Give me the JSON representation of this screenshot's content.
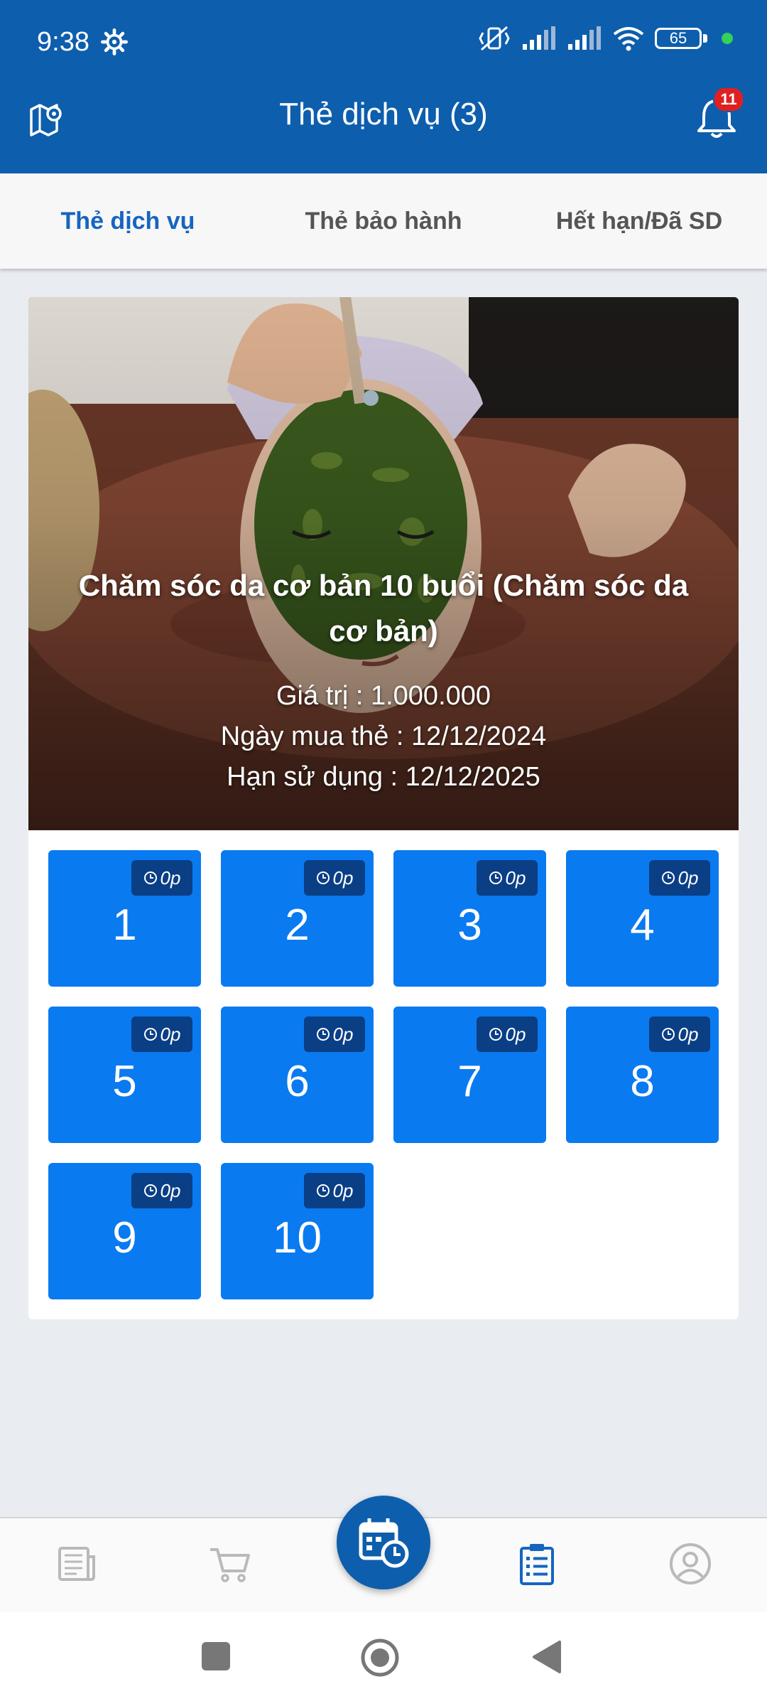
{
  "status_bar": {
    "time": "9:38",
    "battery": "65"
  },
  "header": {
    "title": "Thẻ dịch vụ (3)",
    "notification_count": "11"
  },
  "tabs": [
    {
      "label": "Thẻ dịch vụ",
      "active": true
    },
    {
      "label": "Thẻ bảo hành",
      "active": false
    },
    {
      "label": "Hết hạn/Đã SD",
      "active": false
    }
  ],
  "card": {
    "title": "Chăm sóc da cơ bản 10 buổi (Chăm sóc da cơ bản)",
    "value_line": "Giá trị : 1.000.000",
    "purchase_line": "Ngày mua thẻ : 12/12/2024",
    "expiry_line": "Hạn sử dụng : 12/12/2025",
    "sessions": [
      {
        "number": "1",
        "time": "0p"
      },
      {
        "number": "2",
        "time": "0p"
      },
      {
        "number": "3",
        "time": "0p"
      },
      {
        "number": "4",
        "time": "0p"
      },
      {
        "number": "5",
        "time": "0p"
      },
      {
        "number": "6",
        "time": "0p"
      },
      {
        "number": "7",
        "time": "0p"
      },
      {
        "number": "8",
        "time": "0p"
      },
      {
        "number": "9",
        "time": "0p"
      },
      {
        "number": "10",
        "time": "0p"
      }
    ]
  },
  "bottom_nav": {
    "items": [
      "newspaper-icon",
      "cart-icon",
      "calendar-clock-icon",
      "clipboard-list-icon",
      "account-icon"
    ],
    "active": "clipboard-list-icon"
  },
  "colors": {
    "primary": "#0d5ead",
    "session_tile": "#0a7af0",
    "badge": "#e02020"
  }
}
